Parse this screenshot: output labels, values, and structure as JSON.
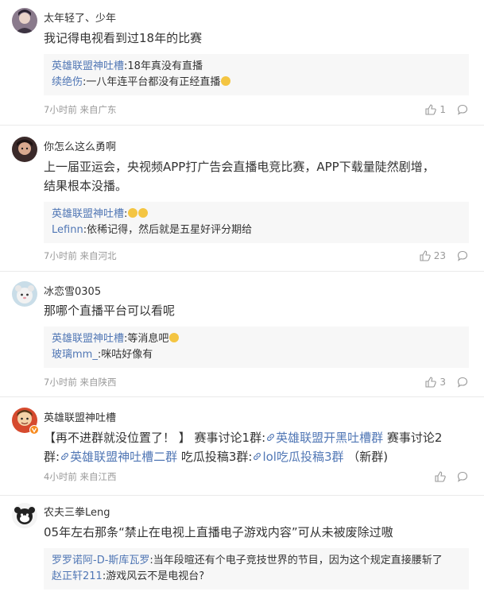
{
  "icons": {
    "like": "thumbs-up-icon",
    "reply": "comment-bubble-icon",
    "link": "link-chain-icon",
    "emoji": "laughing-emoji-icon",
    "verified": "verified-badge-icon"
  },
  "colors": {
    "link_blue": "#5177b5",
    "meta_gray": "#999999",
    "reply_bg": "#f7f7f7",
    "verified_orange": "#f78b1f"
  },
  "comments": [
    {
      "user": "太年轻了、少年",
      "text": "我记得电视看到过18年的比赛",
      "replies": [
        {
          "user": "英雄联盟神吐槽",
          "text": ":18年真没有直播"
        },
        {
          "user": "续绝伤",
          "text": ":一八年连平台都没有正经直播"
        }
      ],
      "meta": "7小时前 来自广东",
      "likes": "1"
    },
    {
      "user": "你怎么这么勇啊",
      "text_line1": "上一届亚运会，央视频APP打广告会直播电竞比赛，APP下载量陡然剧增，",
      "text_line2": "结果根本没播。",
      "replies": [
        {
          "user": "英雄联盟神吐槽",
          "text": ":"
        },
        {
          "user": "Lefinn",
          "text": ":依稀记得，然后就是五星好评分期给"
        }
      ],
      "meta": "7小时前 来自河北",
      "likes": "23"
    },
    {
      "user": "冰恋雪0305",
      "text": "那哪个直播平台可以看呢",
      "replies": [
        {
          "user": "英雄联盟神吐槽",
          "text": ":等消息吧"
        },
        {
          "user": "玻璃mm_",
          "text": ":咪咕好像有"
        }
      ],
      "meta": "7小时前 来自陕西",
      "likes": "3"
    },
    {
      "user": "英雄联盟神吐槽",
      "text_a": "【再不进群就没位置了！ 】 赛事讨论1群:",
      "link_a": "英雄联盟开黑吐槽群",
      "text_b": " 赛事讨论2",
      "text_c": "群:",
      "link_b": "英雄联盟神吐槽二群",
      "text_d": " 吃瓜投稿3群:",
      "link_c": "lol吃瓜投稿3群",
      "text_e": " （新群)",
      "meta": "4小时前 来自江西"
    },
    {
      "user": "农夫三拳Leng",
      "text": "05年左右那条“禁止在电视上直播电子游戏内容”可从未被废除过嗷",
      "replies": [
        {
          "user": "罗罗诺阿-D-斯库瓦罗",
          "text": ":当年段暄还有个电子竞技世界的节目，因为这个规定直接腰斩了"
        },
        {
          "user": "赵正轩211",
          "text": ":游戏风云不是电视台?"
        }
      ]
    }
  ]
}
